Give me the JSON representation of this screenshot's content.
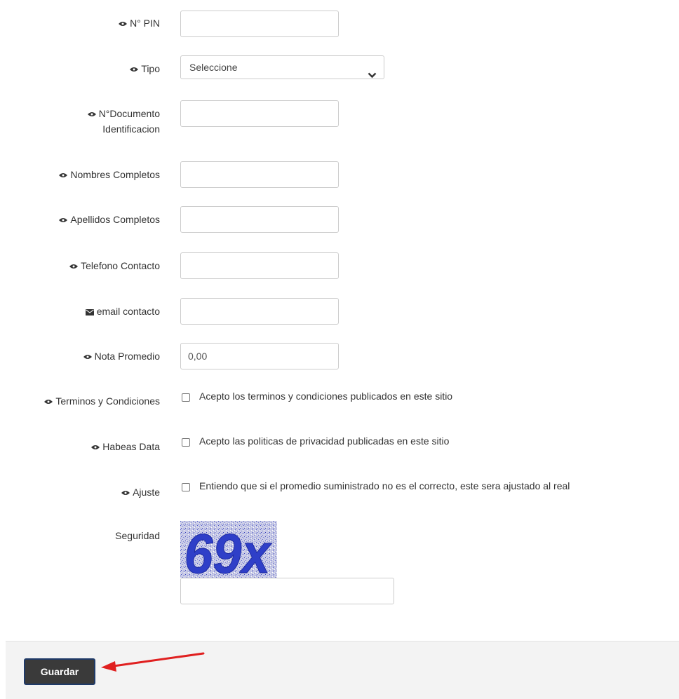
{
  "form": {
    "pin": {
      "label": "N° PIN",
      "value": ""
    },
    "tipo": {
      "label": "Tipo",
      "selected": "Seleccione"
    },
    "documento": {
      "label_line1": "N°Documento",
      "label_line2": "Identificacion",
      "value": ""
    },
    "nombres": {
      "label": "Nombres Completos",
      "value": ""
    },
    "apellidos": {
      "label": "Apellidos Completos",
      "value": ""
    },
    "telefono": {
      "label": "Telefono Contacto",
      "value": ""
    },
    "email": {
      "label": "email contacto",
      "value": ""
    },
    "nota": {
      "label": "Nota Promedio",
      "value": "0,00"
    },
    "terminos": {
      "label": "Terminos y Condiciones",
      "checkbox_text": "Acepto los terminos y condiciones publicados en este sitio",
      "checked": false
    },
    "habeas": {
      "label": "Habeas Data",
      "checkbox_text": "Acepto las politicas de privacidad publicadas en este sitio",
      "checked": false
    },
    "ajuste": {
      "label": "Ajuste",
      "checkbox_text": "Entiendo que si el promedio suministrado no es el correcto, este sera ajustado al real",
      "checked": false
    },
    "seguridad": {
      "label": "Seguridad",
      "captcha_text": "69x",
      "value": ""
    }
  },
  "footer": {
    "save_label": "Guardar"
  },
  "icons": {
    "field": "eye-icon",
    "email": "envelope-icon",
    "select": "chevron-down-icon",
    "annotation": "arrow-icon"
  },
  "colors": {
    "button_bg": "#3a3a3a",
    "button_border": "#1f3a68",
    "arrow": "#e02020",
    "captcha_text": "#2f3fc8"
  }
}
